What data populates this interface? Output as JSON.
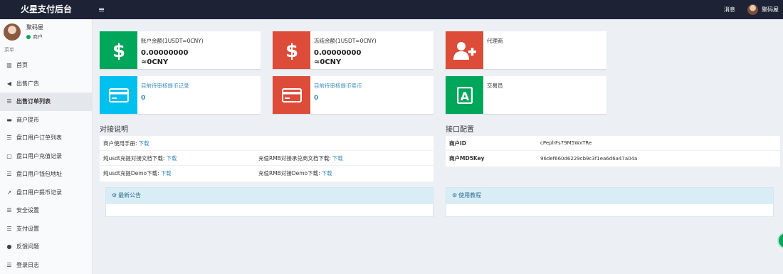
{
  "header": {
    "brand": "火星支付后台",
    "menu_toggle": "≡",
    "messages": "消息",
    "user": "聚码屋"
  },
  "sidebar": {
    "user_name": "聚码屋",
    "user_role": "商户",
    "menu_header": "菜单",
    "items": [
      {
        "icon": "▥",
        "label": "首页"
      },
      {
        "icon": "◀",
        "label": "出售广告"
      },
      {
        "icon": "☰",
        "label": "出售订单列表"
      },
      {
        "icon": "▬",
        "label": "商户提币"
      },
      {
        "icon": "☰",
        "label": "盘口用户订单列表"
      },
      {
        "icon": "▢",
        "label": "盘口用户充值记录"
      },
      {
        "icon": "☰",
        "label": "盘口用户钱包地址"
      },
      {
        "icon": "↗",
        "label": "盘口用户提币记录"
      },
      {
        "icon": "☰",
        "label": "安全设置"
      },
      {
        "icon": "☰",
        "label": "支付设置"
      },
      {
        "icon": "●",
        "label": "反馈问题"
      },
      {
        "icon": "☰",
        "label": "登录日志"
      }
    ]
  },
  "cards": {
    "balance": {
      "label": "账户余额(1USDT=0CNY)",
      "value": "0.00000000",
      "cny": "≈0CNY"
    },
    "frozen": {
      "label": "冻结余额(1USDT=0CNY)",
      "value": "0.00000000",
      "cny": "≈0CNY"
    },
    "agent": {
      "label": "代理商"
    },
    "pending_withdraw": {
      "label": "目前待审核提币记录",
      "value": "0"
    },
    "pending_sell": {
      "label": "目前待审核提币卖币",
      "value": "0"
    },
    "trader": {
      "label": "交易员"
    }
  },
  "integration": {
    "title": "对接说明",
    "manual_label": "商户使用手册:",
    "manual_link": "下载",
    "usdt_doc_label": "纯usdt充提对接文档下载:",
    "usdt_doc_link": "下载",
    "rmb_doc_label": "充值RMB对接承兑商文档下载:",
    "rmb_doc_link": "下载",
    "usdt_demo_label": "纯usdt充提Demo下载:",
    "usdt_demo_link": "下载",
    "rmb_demo_label": "充值RMB对接Demo下载:",
    "rmb_demo_link": "下载"
  },
  "api_config": {
    "title": "接口配置",
    "rows": [
      {
        "key": "商户ID",
        "value": "cPephFs79M5WxTRe"
      },
      {
        "key": "商户MD5Key",
        "value": "96def660d6229cb9c3f1ea6d6a47a04a"
      }
    ]
  },
  "notice_box": {
    "title": "最新公告"
  },
  "tutorial_box": {
    "title": "使用教程"
  }
}
